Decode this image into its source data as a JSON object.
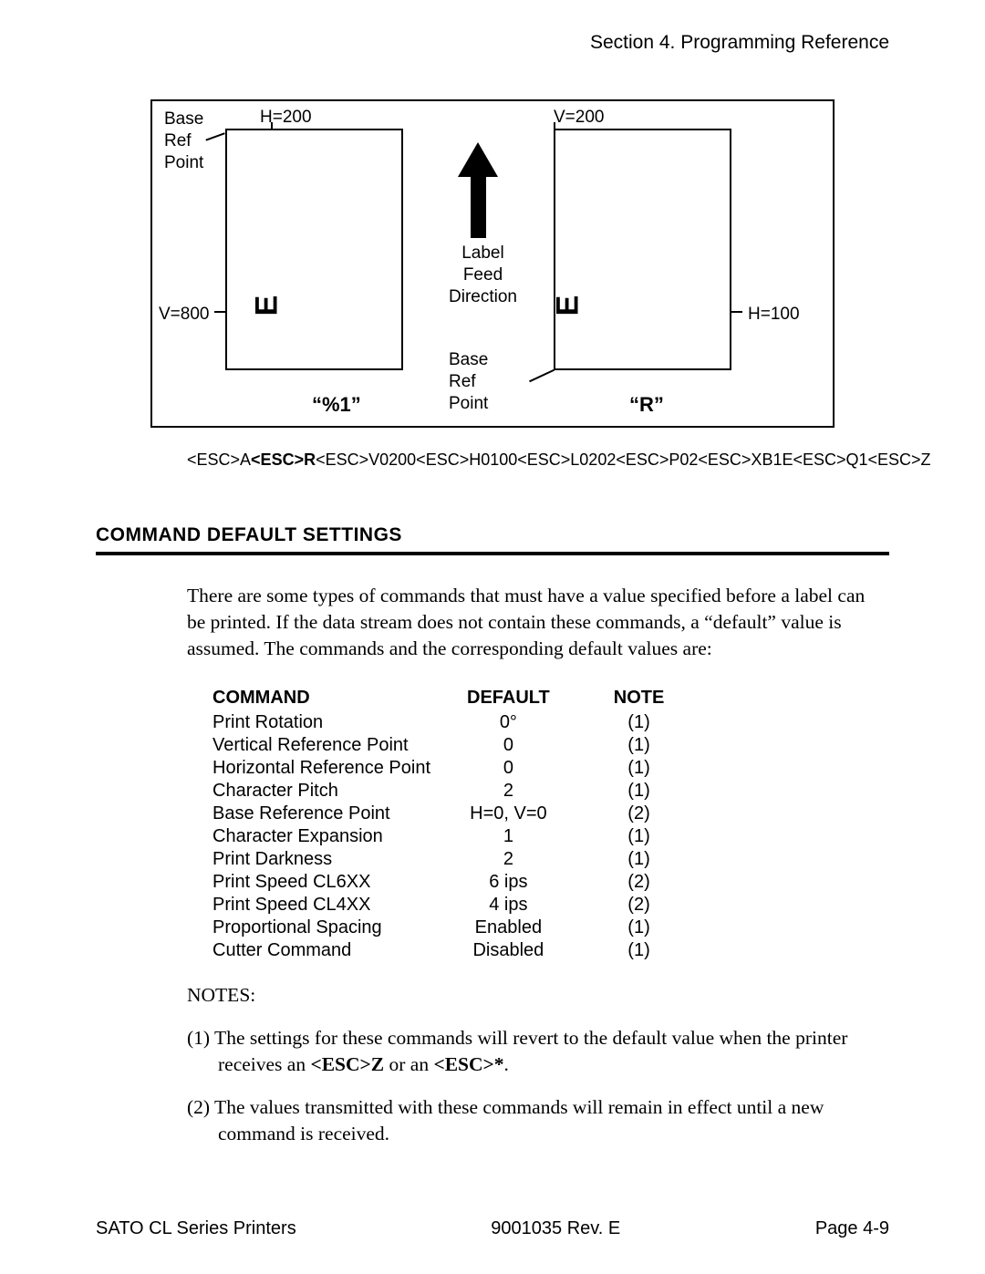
{
  "header": {
    "section": "Section 4. Programming Reference"
  },
  "diagram": {
    "base_ref_1": "Base\nRef\nPoint",
    "h200": "H=200",
    "v200": "V=200",
    "label_feed": "Label\nFeed\nDirection",
    "v800": "V=800",
    "h100": "H=100",
    "base_ref_2": "Base\nRef\nPoint",
    "left_title": "“%1”",
    "right_title": "“R”",
    "glyph1": "E",
    "glyph2": "E"
  },
  "code": {
    "p1": "<ESC>A",
    "b1": "<ESC>R",
    "p2": "<ESC>V0200<ESC>H0100<ESC>L0202<ESC>P02<ESC>XB1E<ESC>Q1<ESC>Z"
  },
  "section_title": "COMMAND DEFAULT SETTINGS",
  "para": "There are some types of commands that must have a value specified before a label can be printed. If the data stream does not contain these commands, a “default” value is assumed. The commands and the corresponding default values are:",
  "table": {
    "headers": [
      "COMMAND",
      "DEFAULT",
      "NOTE"
    ],
    "rows": [
      [
        "Print Rotation",
        "0°",
        "(1)"
      ],
      [
        "Vertical Reference Point",
        "0",
        "(1)"
      ],
      [
        "Horizontal Reference Point",
        "0",
        "(1)"
      ],
      [
        "Character Pitch",
        "2",
        "(1)"
      ],
      [
        "Base Reference Point",
        "H=0, V=0",
        "(2)"
      ],
      [
        "Character Expansion",
        "1",
        "(1)"
      ],
      [
        "Print Darkness",
        "2",
        "(1)"
      ],
      [
        "Print Speed CL6XX",
        "6 ips",
        "(2)"
      ],
      [
        "Print Speed CL4XX",
        "4 ips",
        "(2)"
      ],
      [
        "Proportional Spacing",
        "Enabled",
        "(1)"
      ],
      [
        "Cutter Command",
        "Disabled",
        "(1)"
      ]
    ]
  },
  "notes_label": "NOTES:",
  "notes": {
    "n1_pre": "(1) The settings for these commands will revert to the default value when the printer receives an ",
    "n1_b1": "<ESC>Z",
    "n1_mid": " or an ",
    "n1_b2": "<ESC>*",
    "n1_post": ".",
    "n2": "(2) The values transmitted with these commands will remain in effect until a new command is received."
  },
  "footer": {
    "left": "SATO CL Series Printers",
    "center": "9001035 Rev. E",
    "right": "Page 4-9"
  }
}
